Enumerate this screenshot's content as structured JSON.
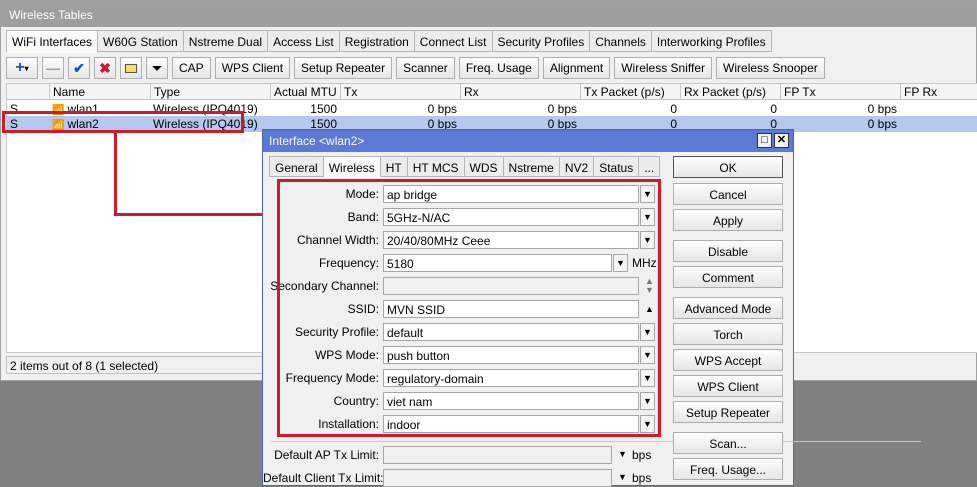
{
  "window": {
    "title": "Wireless Tables"
  },
  "tabs": [
    "WiFi Interfaces",
    "W60G Station",
    "Nstreme Dual",
    "Access List",
    "Registration",
    "Connect List",
    "Security Profiles",
    "Channels",
    "Interworking Profiles"
  ],
  "toolbar": {
    "cap": "CAP",
    "wps_client": "WPS Client",
    "setup_repeater": "Setup Repeater",
    "scanner": "Scanner",
    "freq_usage": "Freq. Usage",
    "alignment": "Alignment",
    "wireless_sniffer": "Wireless Sniffer",
    "wireless_snooper": "Wireless Snooper"
  },
  "table": {
    "columns": [
      "",
      "Name",
      "Type",
      "Actual MTU",
      "Tx",
      "Rx",
      "Tx Packet (p/s)",
      "Rx Packet (p/s)",
      "FP Tx",
      "FP Rx"
    ],
    "rows": [
      {
        "flag": "S",
        "name": "wlan1",
        "type": "Wireless (IPQ4019)",
        "mtu": "1500",
        "tx": "0 bps",
        "rx": "0 bps",
        "txp": "0",
        "rxp": "0",
        "fptx": "0 bps"
      },
      {
        "flag": "S",
        "name": "wlan2",
        "type": "Wireless (IPQ4019)",
        "mtu": "1500",
        "tx": "0 bps",
        "rx": "0 bps",
        "txp": "0",
        "rxp": "0",
        "fptx": "0 bps"
      }
    ]
  },
  "status": "2 items out of 8 (1 selected)",
  "dialog": {
    "title": "Interface <wlan2>",
    "tabs": [
      "General",
      "Wireless",
      "HT",
      "HT MCS",
      "WDS",
      "Nstreme",
      "NV2",
      "Status",
      "..."
    ],
    "fields": {
      "mode": {
        "label": "Mode:",
        "value": "ap bridge"
      },
      "band": {
        "label": "Band:",
        "value": "5GHz-N/AC"
      },
      "channel_width": {
        "label": "Channel Width:",
        "value": "20/40/80MHz Ceee"
      },
      "frequency": {
        "label": "Frequency:",
        "value": "5180",
        "unit": "MHz"
      },
      "secondary_channel": {
        "label": "Secondary Channel:",
        "value": ""
      },
      "ssid": {
        "label": "SSID:",
        "value": "MVN SSID"
      },
      "security_profile": {
        "label": "Security Profile:",
        "value": "default"
      },
      "wps_mode": {
        "label": "WPS Mode:",
        "value": "push button"
      },
      "frequency_mode": {
        "label": "Frequency Mode:",
        "value": "regulatory-domain"
      },
      "country": {
        "label": "Country:",
        "value": "viet nam"
      },
      "installation": {
        "label": "Installation:",
        "value": "indoor"
      },
      "default_ap_tx_limit": {
        "label": "Default AP Tx Limit:",
        "value": "",
        "unit": "bps"
      },
      "default_client_tx_limit": {
        "label": "Default Client Tx Limit:",
        "value": "",
        "unit": "bps"
      }
    },
    "buttons": [
      "OK",
      "Cancel",
      "Apply",
      "Disable",
      "Comment",
      "Advanced Mode",
      "Torch",
      "WPS Accept",
      "WPS Client",
      "Setup Repeater",
      "Scan...",
      "Freq. Usage..."
    ]
  },
  "colors": {
    "title_bar": "#5a7ad6",
    "annotation_red": "#d0192d",
    "selection": "#b3c8ec"
  }
}
